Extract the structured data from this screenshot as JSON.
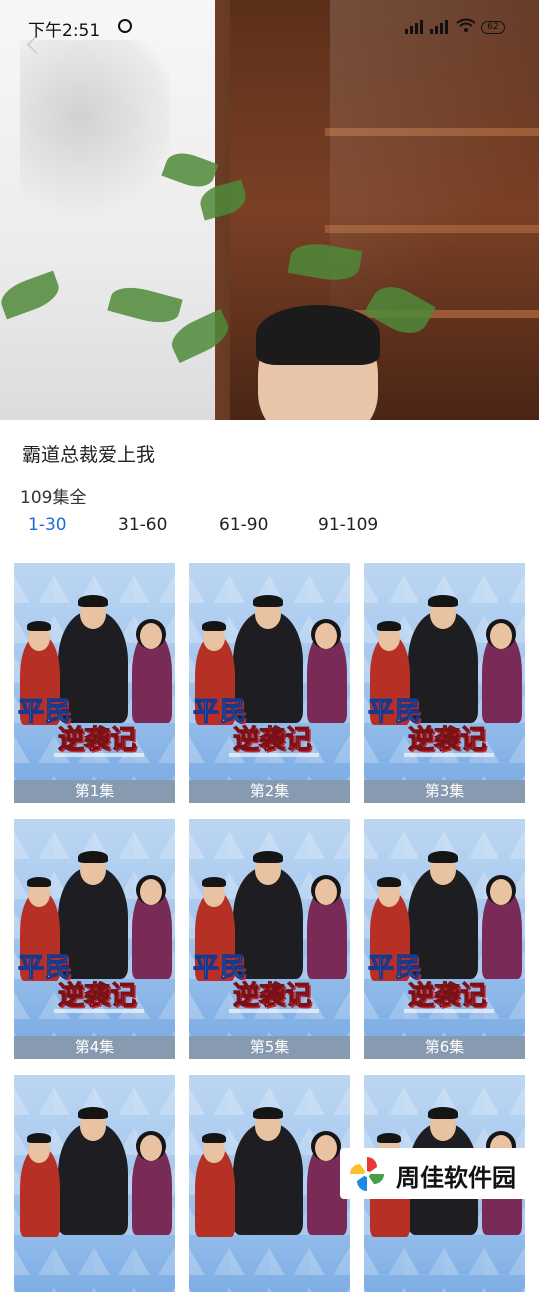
{
  "status_bar": {
    "time": "下午2:51",
    "battery": "62",
    "icons": [
      "alarm-icon",
      "signal-icon",
      "wifi-icon",
      "battery-icon"
    ]
  },
  "drama": {
    "title": "霸道总裁爱上我",
    "episode_count": "109集全"
  },
  "tabs": [
    {
      "label": "1-30",
      "active": true
    },
    {
      "label": "31-60",
      "active": false
    },
    {
      "label": "61-90",
      "active": false
    },
    {
      "label": "91-109",
      "active": false
    }
  ],
  "poster_text": {
    "line1": "平民",
    "line2": "逆袭记"
  },
  "episodes": [
    {
      "label": "第1集"
    },
    {
      "label": "第2集"
    },
    {
      "label": "第3集"
    },
    {
      "label": "第4集"
    },
    {
      "label": "第5集"
    },
    {
      "label": "第6集"
    },
    {
      "label": ""
    },
    {
      "label": ""
    },
    {
      "label": ""
    }
  ],
  "watermark": {
    "text": "周佳软件园"
  },
  "colors": {
    "accent": "#1a6be0",
    "text": "#222222"
  }
}
